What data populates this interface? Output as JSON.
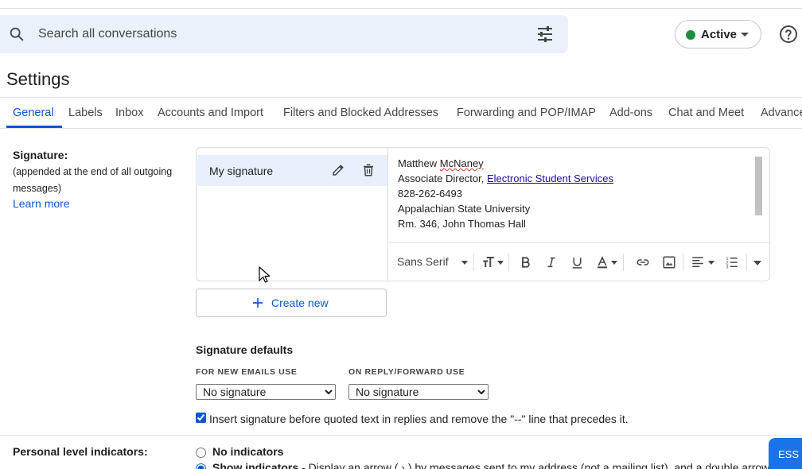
{
  "search": {
    "placeholder": "Search all conversations",
    "icon": "search-icon",
    "options_icon": "tune-icon"
  },
  "status": {
    "label": "Active",
    "color": "#1e8e3e"
  },
  "help": {
    "icon": "help-icon"
  },
  "page": {
    "title": "Settings"
  },
  "tabs": [
    {
      "label": "General",
      "active": true
    },
    {
      "label": "Labels"
    },
    {
      "label": "Inbox"
    },
    {
      "label": "Accounts and Import"
    },
    {
      "label": "Filters and Blocked Addresses"
    },
    {
      "label": "Forwarding and POP/IMAP"
    },
    {
      "label": "Add-ons"
    },
    {
      "label": "Chat and Meet"
    },
    {
      "label": "Advanced"
    }
  ],
  "signature": {
    "label": "Signature:",
    "description": "(appended at the end of all outgoing messages)",
    "learn_more": "Learn more",
    "items": [
      {
        "name": "My signature"
      }
    ],
    "content": {
      "first_name": "Matthew",
      "last_name": "McNaney",
      "title_prefix": "Associate Director,",
      "title_link": "Electronic Student Services",
      "phone": "828-262-6493",
      "org": "Appalachian State University",
      "room": "Rm. 346, John Thomas Hall"
    },
    "toolbar": {
      "font": "Sans Serif"
    },
    "create_new": "Create new"
  },
  "defaults": {
    "title": "Signature defaults",
    "new_label": "FOR NEW EMAILS USE",
    "reply_label": "ON REPLY/FORWARD USE",
    "new_value": "No signature",
    "reply_value": "No signature",
    "insert_checked": true,
    "insert_text": "Insert signature before quoted text in replies and remove the \"--\" line that precedes it."
  },
  "personal_indicators": {
    "label": "Personal level indicators:",
    "options": [
      {
        "title": "No indicators",
        "text": "",
        "checked": false
      },
      {
        "title": "Show indicators",
        "text": " - Display an arrow ( › ) by messages sent to my address (not a mailing list), and a double arrow",
        "checked": true
      }
    ]
  },
  "chat_bubble": {
    "label": "ESS S"
  },
  "colors": {
    "accent": "#0b57d0",
    "selected_bg": "#e8f0fe",
    "search_bg": "#eaf1fb"
  }
}
